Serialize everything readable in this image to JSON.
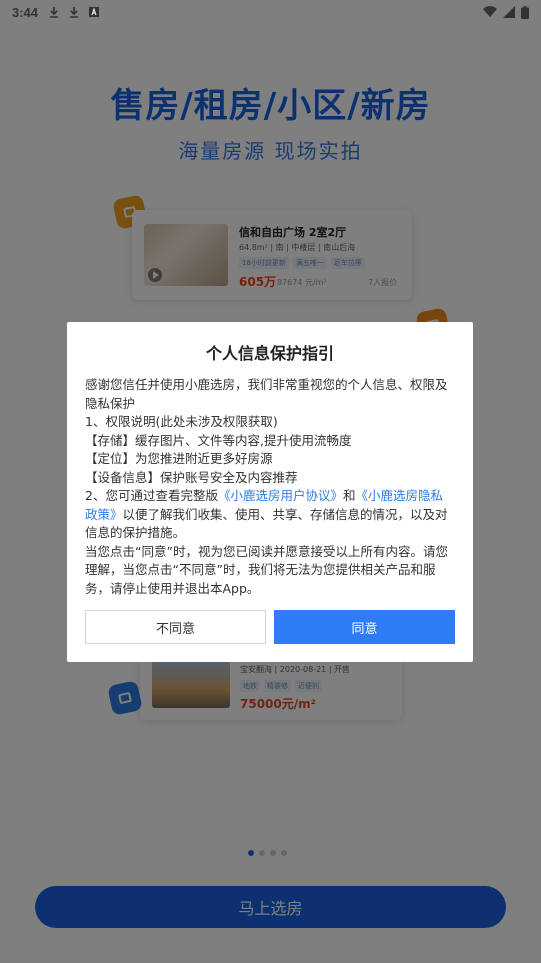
{
  "status_bar": {
    "time": "3:44"
  },
  "hero": {
    "title": "售房/租房/小区/新房",
    "subtitle": "海量房源 现场实拍"
  },
  "card1": {
    "title": "信和自由广场 2室2厅",
    "meta": "64.8m² | 南 | 中楼层 | 南山后海",
    "tags": [
      "18小时前更新",
      "满五唯一",
      "近车位等"
    ],
    "price": "605万",
    "unit_price": "87674 元/m²",
    "extra": "7人报价"
  },
  "card2": {
    "meta": "宝安翻海 | 2020-08-21 | 开售",
    "tags": [
      "地铁",
      "精装修",
      "近便利"
    ],
    "price": "75000元/m²"
  },
  "dialog": {
    "title": "个人信息保护指引",
    "p1": "感谢您信任并使用小鹿选房，我们非常重视您的个人信息、权限及隐私保护",
    "p2": "1、权限说明(此处未涉及权限获取)",
    "p3": "【存储】缓存图片、文件等内容,提升使用流畅度",
    "p4": "【定位】为您推进附近更多好房源",
    "p5": "【设备信息】保护账号安全及内容推荐",
    "p6_pre": "2、您可通过查看完整版",
    "p6_link1": "《小鹿选房用户协议》",
    "p6_mid": "和",
    "p6_link2": "《小鹿选房隐私政策》",
    "p6_post": "以便了解我们收集、使用、共享、存储信息的情况，以及对信息的保护措施。",
    "p7": "当您点击“同意”时，视为您已阅读并愿意接受以上所有内容。请您理解，当您点击“不同意”时，我们将无法为您提供相关产品和服务，请停止使用并退出本App。",
    "disagree_label": "不同意",
    "agree_label": "同意"
  },
  "cta_label": "马上选房",
  "colors": {
    "brand": "#1a63e0",
    "agree": "#2e7cf6",
    "link": "#2e7be4"
  }
}
